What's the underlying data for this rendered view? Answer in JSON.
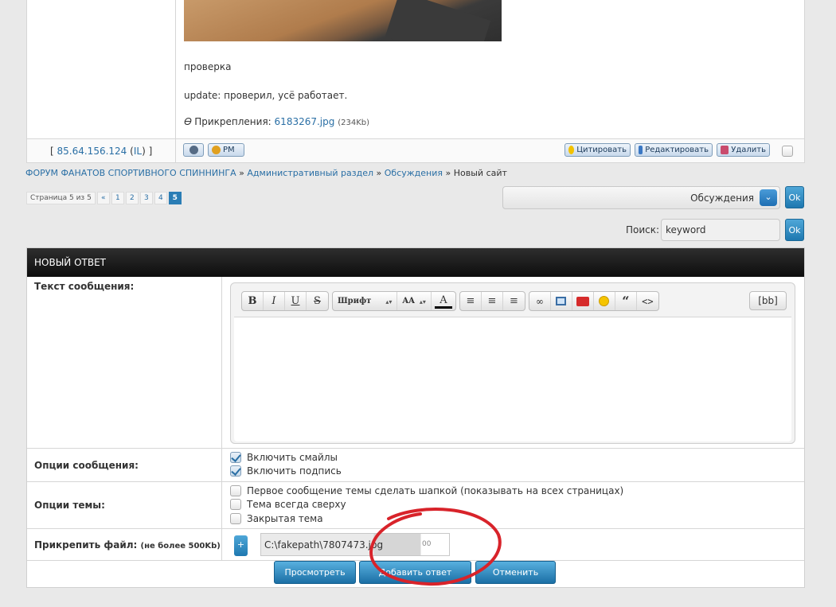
{
  "post": {
    "text_check": "проверка",
    "text_update": "update: проверил, усё работает.",
    "attachments_label": "Прикрепления:",
    "attachment_file": "6183267.jpg",
    "attachment_size": "(234Kb)",
    "ip_prefix": "[",
    "ip": "85.64.156.124",
    "ip_country_open": "(",
    "ip_country": "IL",
    "ip_country_close": ")",
    "ip_suffix": "]",
    "pm_label": "PM",
    "quote_label": "Цитировать",
    "edit_label": "Редактировать",
    "delete_label": "Удалить"
  },
  "breadcrumb": {
    "items": [
      "ФОРУМ ФАНАТОВ СПОРТИВНОГО СПИННИНГА",
      "Административный раздел",
      "Обсуждения"
    ],
    "separator": "»",
    "current": "Новый сайт"
  },
  "pagination": {
    "label": "Страница 5 из 5",
    "prev": "«",
    "pages": [
      "1",
      "2",
      "3",
      "4",
      "5"
    ],
    "current": "5"
  },
  "forum_jump": {
    "selected": "Обсуждения",
    "ok": "Ok"
  },
  "search": {
    "label": "Поиск:",
    "value": "keyword",
    "ok": "Ok"
  },
  "reply": {
    "title": "Новый ответ",
    "message_label": "Текст сообщения:",
    "toolbar": {
      "bold": "B",
      "italic": "I",
      "underline": "U",
      "strike": "S",
      "font": "Шрифт",
      "size": "AA",
      "color": "A",
      "bb": "[bb]"
    },
    "message_options_label": "Опции сообщения:",
    "message_options": [
      "Включить смайлы",
      "Включить подпись"
    ],
    "topic_options_label": "Опции темы:",
    "topic_options": [
      "Первое сообщение темы сделать шапкой (показывать на всех страницах)",
      "Тема всегда сверху",
      "Закрытая тема"
    ],
    "attach_label": "Прикрепить файл:",
    "attach_limit": "(не более 500Kb)",
    "attach_add": "+",
    "attach_path": "C:\\fakepath\\7807473.jpg",
    "attach_tail": "00",
    "preview_button": "Просмотреть",
    "submit_button": "Добавить ответ",
    "cancel_button": "Отменить"
  },
  "colors": {
    "accent": "#2a7db5",
    "header_bg": "#0d0d0d",
    "annotation": "#d8232a"
  }
}
